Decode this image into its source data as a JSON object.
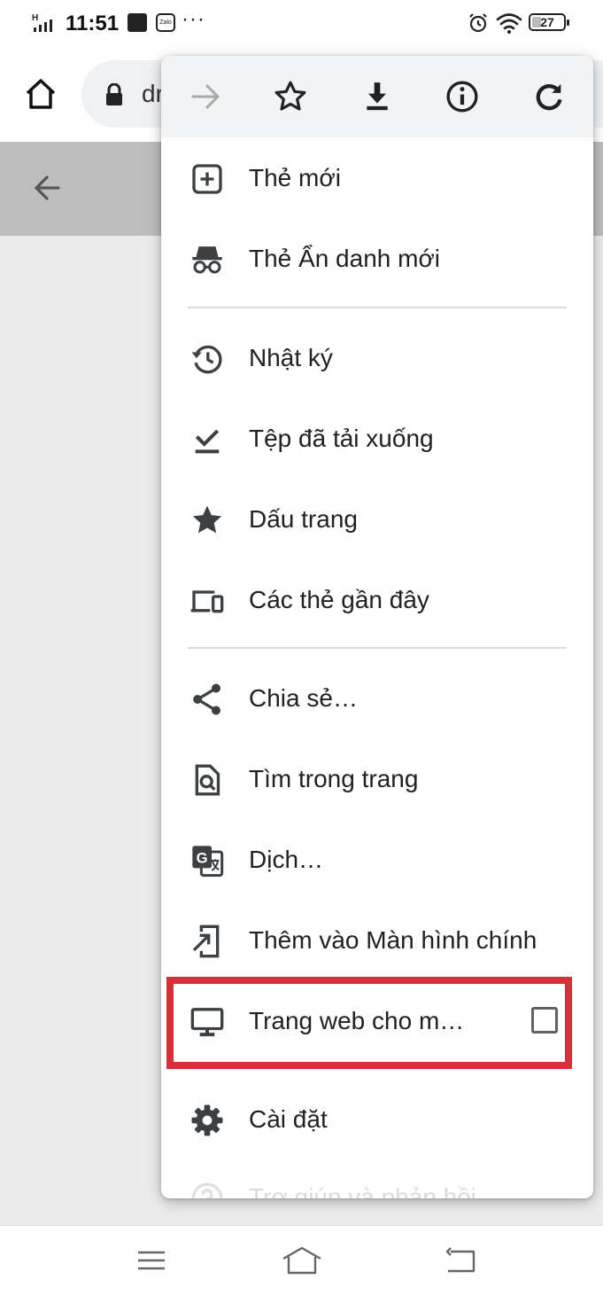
{
  "status_bar": {
    "time": "11:51",
    "network": "H",
    "battery": "27",
    "zalo_label": "Zalo",
    "more": "···"
  },
  "toolbar": {
    "url": "dr"
  },
  "menu": {
    "top_icons": [
      "forward-icon",
      "bookmark-star-icon",
      "download-icon",
      "info-icon",
      "reload-icon"
    ],
    "items": [
      {
        "label": "Thẻ mới",
        "icon": "new-tab-icon"
      },
      {
        "label": "Thẻ Ẩn danh mới",
        "icon": "incognito-icon"
      },
      {
        "label": "Nhật ký",
        "icon": "history-icon"
      },
      {
        "label": "Tệp đã tải xuống",
        "icon": "downloads-icon"
      },
      {
        "label": "Dấu trang",
        "icon": "bookmarks-icon"
      },
      {
        "label": "Các thẻ gần đây",
        "icon": "recent-tabs-icon"
      },
      {
        "label": "Chia sẻ…",
        "icon": "share-icon"
      },
      {
        "label": "Tìm trong trang",
        "icon": "find-in-page-icon"
      },
      {
        "label": "Dịch…",
        "icon": "translate-icon"
      },
      {
        "label": "Thêm vào Màn hình chính",
        "icon": "add-to-home-icon"
      },
      {
        "label": "Trang web cho m…",
        "icon": "desktop-icon",
        "checked": false
      },
      {
        "label": "Cài đặt",
        "icon": "settings-icon"
      },
      {
        "label": "Trợ giúp và phản hồi",
        "icon": "help-icon"
      }
    ]
  },
  "colors": {
    "highlight": "#d8303a",
    "menu_header_bg": "#f2f3f5",
    "page_header_bg": "#bdbdbd"
  }
}
